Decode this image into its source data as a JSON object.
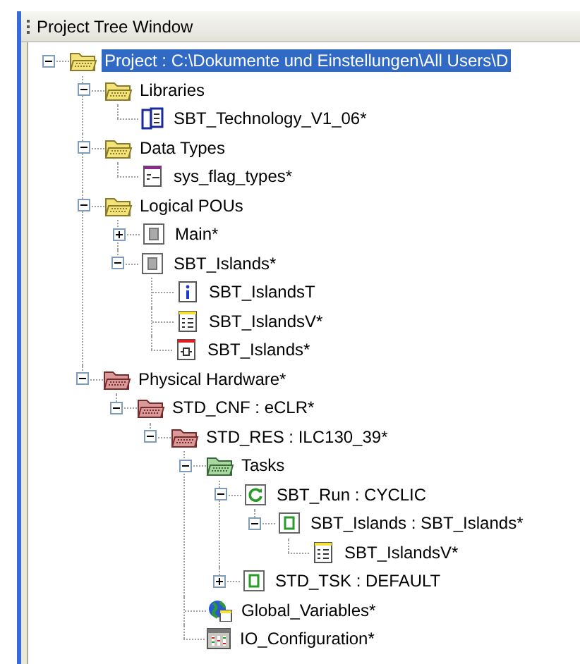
{
  "window": {
    "title": "Project Tree Window"
  },
  "tree": [
    {
      "label": "Project : C:\\Dokumente und Einstellungen\\All Users\\D",
      "kind": "folder",
      "expanded": true,
      "selected": true,
      "children": [
        {
          "label": "Libraries",
          "kind": "folder",
          "expanded": true,
          "selected": false,
          "children": [
            {
              "label": "SBT_Technology_V1_06*",
              "kind": "library",
              "selected": false
            }
          ]
        },
        {
          "label": "Data Types",
          "kind": "folder",
          "expanded": true,
          "selected": false,
          "children": [
            {
              "label": "sys_flag_types*",
              "kind": "datatype",
              "selected": false
            }
          ]
        },
        {
          "label": "Logical POUs",
          "kind": "folder",
          "expanded": true,
          "selected": false,
          "children": [
            {
              "label": "Main*",
              "kind": "pou",
              "expanded": false,
              "selected": false
            },
            {
              "label": "SBT_Islands*",
              "kind": "pou",
              "expanded": true,
              "selected": false,
              "children": [
                {
                  "label": "SBT_IslandsT",
                  "kind": "info",
                  "selected": false
                },
                {
                  "label": "SBT_IslandsV*",
                  "kind": "variables",
                  "selected": false
                },
                {
                  "label": "SBT_Islands*",
                  "kind": "code",
                  "selected": false
                }
              ]
            }
          ]
        },
        {
          "label": "Physical Hardware*",
          "kind": "hardware",
          "expanded": true,
          "selected": false,
          "children": [
            {
              "label": "STD_CNF : eCLR*",
              "kind": "hardware",
              "expanded": true,
              "selected": false,
              "children": [
                {
                  "label": "STD_RES : ILC130_39*",
                  "kind": "hardware",
                  "expanded": true,
                  "selected": false,
                  "children": [
                    {
                      "label": "Tasks",
                      "kind": "tasks",
                      "expanded": true,
                      "selected": false,
                      "children": [
                        {
                          "label": "SBT_Run : CYCLIC",
                          "kind": "cyclic",
                          "expanded": true,
                          "selected": false,
                          "children": [
                            {
                              "label": "SBT_Islands : SBT_Islands*",
                              "kind": "program",
                              "expanded": true,
                              "selected": false,
                              "children": [
                                {
                                  "label": "SBT_IslandsV*",
                                  "kind": "variables",
                                  "selected": false
                                }
                              ]
                            }
                          ]
                        },
                        {
                          "label": "STD_TSK : DEFAULT",
                          "kind": "program",
                          "expanded": false,
                          "selected": false
                        }
                      ]
                    },
                    {
                      "label": "Global_Variables*",
                      "kind": "globe",
                      "selected": false
                    },
                    {
                      "label": "IO_Configuration*",
                      "kind": "io",
                      "selected": false
                    }
                  ]
                }
              ]
            }
          ]
        }
      ]
    }
  ]
}
